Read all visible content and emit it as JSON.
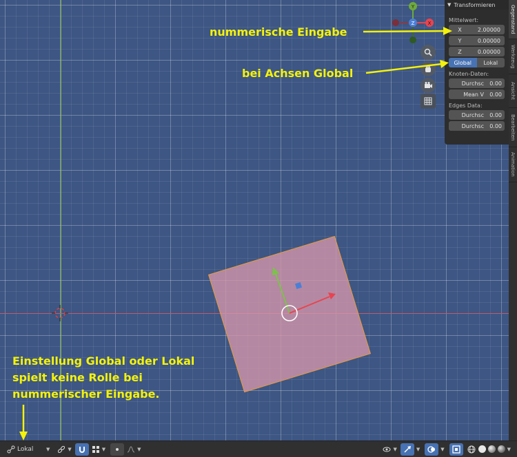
{
  "panel": {
    "title": "Transformieren",
    "median_label": "Mittelwert:",
    "x_label": "X",
    "x_value": "2.00000",
    "y_label": "Y",
    "y_value": "0.00000",
    "z_label": "Z",
    "z_value": "0.00000",
    "global_label": "Global",
    "local_label": "Lokal",
    "vertex_data_label": "Knoten-Daten:",
    "vertex_rows": [
      {
        "label": "Durchsc",
        "value": "0.00"
      },
      {
        "label": "Mean V",
        "value": "0.00"
      }
    ],
    "edges_data_label": "Edges Data:",
    "edge_rows": [
      {
        "label": "Durchsc",
        "value": "0.00"
      },
      {
        "label": "Durchsc",
        "value": "0.00"
      }
    ]
  },
  "tabs": [
    "Gegenstand",
    "Werkzeug",
    "Ansicht",
    "Bearbeiten",
    "Animation"
  ],
  "gizmo": {
    "x": "X",
    "y": "Y",
    "z": "Z"
  },
  "annotations": {
    "numeric_input": "nummerische Eingabe",
    "axes_global": "bei Achsen Global",
    "bottom_line1": "Einstellung Global oder Lokal",
    "bottom_line2": "spielt keine Rolle bei",
    "bottom_line3": "nummerischer Eingabe."
  },
  "toolbar": {
    "orientation_label": "Lokal"
  },
  "icons": [
    "pivot-icon",
    "link-icon",
    "snap-icon",
    "snap-target-icon",
    "proportional-icon",
    "falloff-icon",
    "visibility-icon",
    "gizmo-icon",
    "overlay-icon",
    "xray-icon",
    "zoom-icon",
    "hand-icon",
    "camera-icon",
    "grid-icon",
    "chevron-down-icon"
  ],
  "colors": {
    "annotation": "#f4f20a",
    "accent": "#4772b3",
    "axis_x": "#e8444f",
    "axis_y": "#6faa3c",
    "axis_z": "#4b7fd6",
    "selection_outline": "#e69a38"
  }
}
